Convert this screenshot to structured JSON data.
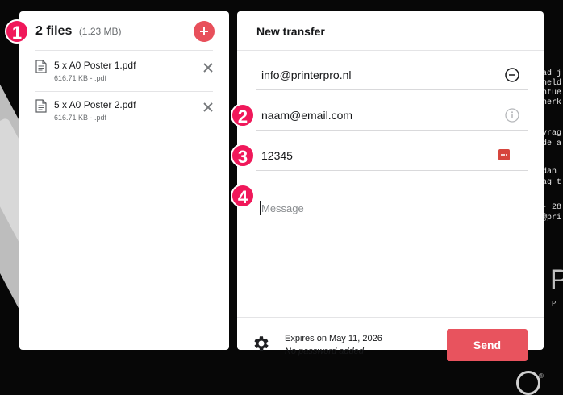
{
  "files": {
    "count_label": "2 files",
    "total_size": "(1.23 MB)",
    "items": [
      {
        "name": "5 x A0 Poster 1.pdf",
        "meta": "616.71 KB - .pdf"
      },
      {
        "name": "5 x A0 Poster 2.pdf",
        "meta": "616.71 KB - .pdf"
      }
    ]
  },
  "transfer": {
    "title": "New transfer",
    "recipient_email": "info@printerpro.nl",
    "sender_email": "naam@email.com",
    "code": "12345",
    "message_placeholder": "Message",
    "expires": "Expires on May 11, 2026",
    "password_status": "No password added",
    "send_label": "Send"
  },
  "markers": [
    "1",
    "2",
    "3",
    "4"
  ],
  "background": {
    "text_fragments": [
      "ad j",
      "held",
      "ntue",
      "nerk",
      "vrag",
      "de a",
      "dan",
      "ag t",
      "- 28",
      "@pri"
    ],
    "logo_letter": "P",
    "logo_sub": "P"
  },
  "colors": {
    "accent": "#e8535e",
    "marker": "#f0185a"
  }
}
